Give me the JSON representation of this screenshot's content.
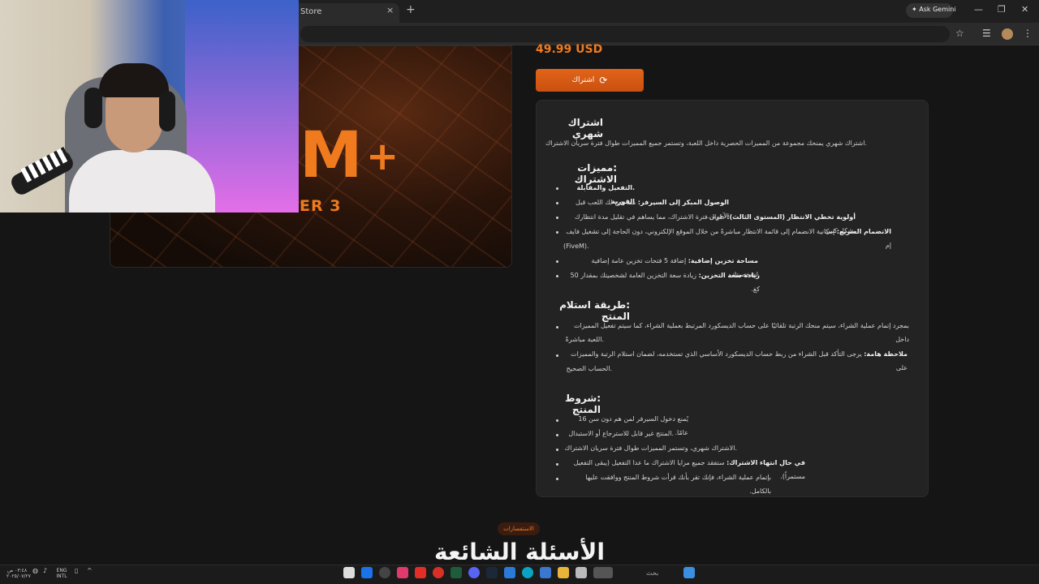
{
  "browser": {
    "tab_title": "Store",
    "tab_close": "×",
    "new_tab": "+",
    "gemini_label": "Ask Gemini",
    "win_min": "—",
    "win_max": "❐",
    "win_close": "✕",
    "star_icon": "☆"
  },
  "product": {
    "logo": "M",
    "logo_plus": "+",
    "tier": "ER 3"
  },
  "price": "49.99 USD",
  "subscribe_button": "اشتراك",
  "card": {
    "title": "اشتراك شهري",
    "intro": ".اشتراك شهري يمنحك مجموعة من المميزات الحصرية داخل اللعبة، وتستمر جميع المميزات طوال فترة سريان الاشتراك",
    "features_heading": ":مميزات الاشتراك",
    "features": [
      {
        "bold": ".التفعيل والمقابلة الفورية",
        "text": ""
      },
      {
        "bold": "الوصول المبكر إلى السيرفر:",
        "text": " مما يتيح لك اللعب قبل الآخرين."
      },
      {
        "bold": "أولوية تخطي الانتظار (المستوى الثالث):",
        "text": " طوال فترة الاشتراك، مما يساهم في تقليل مدة انتظارك بشكل كبير."
      },
      {
        "bold": "الانضمام السريع:",
        "text": " إمكانية الانضمام إلى قائمة الانتظار مباشرةً من خلال الموقع الإلكتروني، دون الحاجة إلى تشغيل فايف إم"
      },
      {
        "bold": "",
        "text": "(FiveM)."
      },
      {
        "bold": "مساحة تخزين إضافية:",
        "text": " إضافة 5 فتحات تخزين عامة إضافية لشخصيتك."
      },
      {
        "bold": "زيادة سعة التخزين:",
        "text": " زيادة سعة التخزين العامة لشخصيتك بمقدار 50 كغ."
      }
    ],
    "delivery_heading": ":طريقة استلام المنتج",
    "delivery": [
      {
        "bold": "",
        "text": "بمجرد إتمام عملية الشراء، سيتم منحك الرتبة تلقائيًا على حساب الديسكورد المرتبط بعملية الشراء، كما سيتم تفعيل المميزات داخل"
      },
      {
        "bold": "",
        "text": ".اللعبة مباشرةً"
      },
      {
        "bold": "ملاحظة هامة:",
        "text": " يرجى التأكد قبل الشراء من ربط حساب الديسكورد الأساسي الذي تستخدمه، لضمان استلام الرتبة والمميزات على"
      },
      {
        "bold": "",
        "text": ".الحساب الصحيح"
      }
    ],
    "terms_heading": ":شروط المنتج",
    "terms": [
      {
        "bold": "",
        "text": "يُمنع دخول السيرفر لمن هم دون سن 16 عامًا."
      },
      {
        "bold": "",
        "text": ".المنتج غير قابل للاسترجاع أو الاستبدال"
      },
      {
        "bold": "",
        "text": ".الاشتراك شهري، وتستمر المميزات طوال فترة سريان الاشتراك"
      },
      {
        "bold": "في حال انتهاء الاشتراك:",
        "text": " ستفقد جميع مزايا الاشتراك ما عدا التفعيل (يبقى التفعيل مستمراً)."
      },
      {
        "bold": "",
        "text": "بإتمام عملية الشراء، فإنك تقر بأنك قرأت شروط المنتج ووافقت عليها بالكامل."
      }
    ]
  },
  "faq_pill": "الاستفسارات",
  "faq_title": "الأسئلة الشائعة",
  "taskbar": {
    "search_placeholder": "بحث",
    "lang1": "ENG",
    "lang2": "INTL",
    "time": "٠٣:٤٨ ص",
    "date": "٢٠٢٥/٠٧/٢٧"
  }
}
